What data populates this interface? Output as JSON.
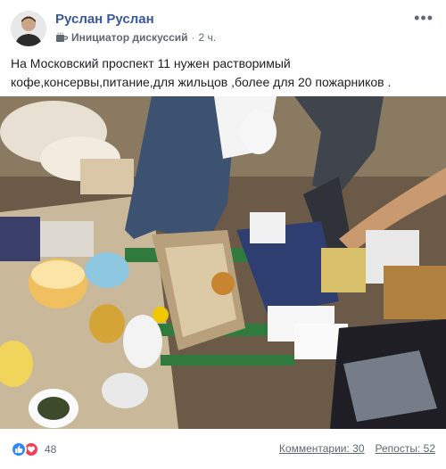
{
  "author": {
    "name": "Руслан Руслан"
  },
  "meta": {
    "badge": "Инициатор дискуссий",
    "separator": "·",
    "time": "2 ч."
  },
  "post": {
    "text_line1": "На Московский проспект 11 нужен растворимый",
    "text_line2": "кофе,консервы,питание,для жильцов ,более для 20 пожарников ."
  },
  "reactions": {
    "count": "48",
    "icons": [
      "like-icon",
      "love-icon"
    ]
  },
  "stats": {
    "comments": "Комментарии: 30",
    "reposts": "Репосты: 52"
  },
  "colors": {
    "link": "#385898",
    "like": "#2d88ff",
    "love": "#f33e58",
    "muted": "#606770"
  }
}
